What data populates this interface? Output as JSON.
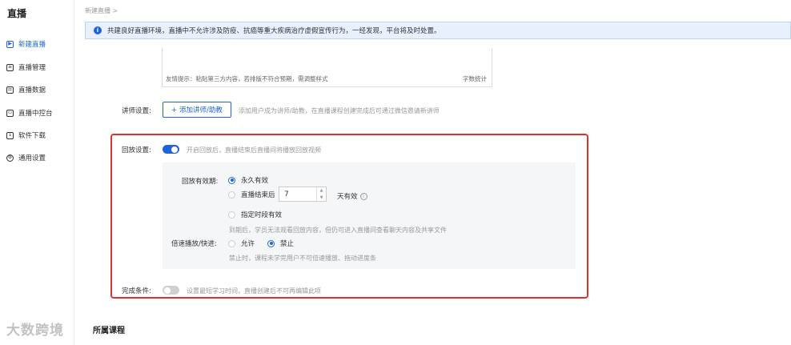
{
  "sidebar": {
    "title": "直播",
    "items": [
      {
        "label": "新建直播",
        "icon": "live-camera-icon",
        "active": true
      },
      {
        "label": "直播管理",
        "icon": "list-icon",
        "active": false
      },
      {
        "label": "直播数据",
        "icon": "data-icon",
        "active": false
      },
      {
        "label": "直播中控台",
        "icon": "monitor-icon",
        "active": false
      },
      {
        "label": "软件下载",
        "icon": "download-icon",
        "active": false
      },
      {
        "label": "通用设置",
        "icon": "gear-icon",
        "active": false
      }
    ]
  },
  "breadcrumb": "新建直播 >",
  "notice": "共建良好直播环境，直播中不允许涉及防疫、抗癌等重大疾病治疗虚假宣传行为，一经发现，平台将及时处置。",
  "editor": {
    "tip": "友情提示：粘贴第三方内容，若排版不符合预期，需调整样式",
    "count_label": "字数统计"
  },
  "lecturer": {
    "label": "讲师设置:",
    "add_button": "+ 添加讲师/助教",
    "hint": "添加用户成为讲师/助教，在直播课程创建完成后可通过微信邀请新讲师"
  },
  "replay": {
    "label": "回放设置:",
    "enabled": true,
    "hint": "开启回放后，直播结束后直播间将播放回放视频",
    "validity_label": "回放有效期:",
    "options": {
      "forever": "永久有效",
      "after_end": "直播结束后",
      "days_value": "7",
      "days_unit": "天有效",
      "specified": "指定时段有效"
    },
    "expire_hint": "到期后，学员无法观看回放内容，但仍可进入直播间查看聊天内容及共享文件",
    "speed_label": "倍速播放/快进:",
    "speed_allow": "允许",
    "speed_forbid": "禁止",
    "speed_hint": "禁止时，课程未学完用户不可倍速播放、拖动进度条"
  },
  "completion": {
    "label": "完成条件:",
    "enabled": false,
    "hint": "设置最短学习时间，直播创建后不可再编辑此项"
  },
  "section_title": "所属课程",
  "watermark": "大数跨境",
  "colors": {
    "accent": "#1e64d8",
    "highlight_box": "#e03030",
    "notice_bg": "#e8f0fd"
  }
}
